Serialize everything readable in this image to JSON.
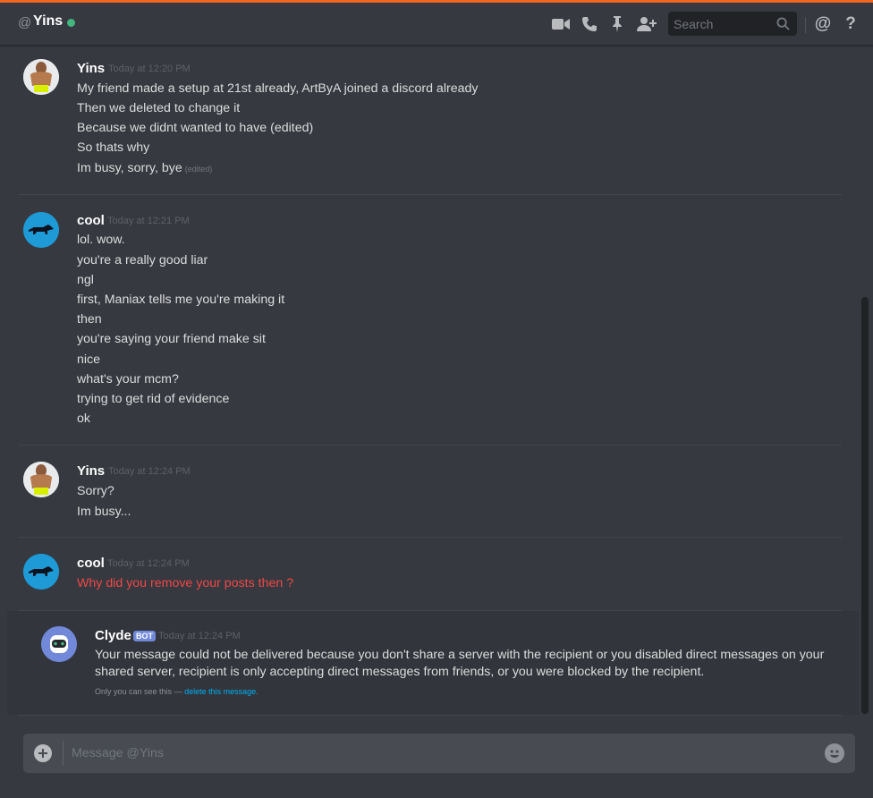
{
  "header": {
    "at_symbol": "@",
    "username": "Yins",
    "status_color": "#43b581",
    "search_placeholder": "Search",
    "icons": [
      "video-icon",
      "phone-icon",
      "pin-icon",
      "add-friend-icon",
      "search-icon",
      "mention-icon",
      "help-icon"
    ],
    "mention_glyph": "@",
    "help_glyph": "?"
  },
  "messages": [
    {
      "author": "Yins",
      "timestamp": "Today at 12:20 PM",
      "lines": [
        "My friend made a setup at 21st already, ArtByA joined a discord already",
        "Then we deleted to change it",
        "Because we didnt wanted to have (edited)",
        "So thats why",
        "Im busy, sorry, bye"
      ],
      "edited_label": "(edited)"
    },
    {
      "author": "cool",
      "timestamp": "Today at 12:21 PM",
      "lines": [
        "lol. wow.",
        "you're a really good liar",
        "ngl",
        "first, Maniax tells me you're making it",
        "then",
        "you're saying your friend make sit",
        "nice",
        "what's your mcm?",
        "trying to get rid of evidence",
        "ok"
      ]
    },
    {
      "author": "Yins",
      "timestamp": "Today at 12:24 PM",
      "lines": [
        "Sorry?",
        "Im busy..."
      ]
    },
    {
      "author": "cool",
      "timestamp": "Today at 12:24 PM",
      "lines": [
        "Why did you remove your posts then ?"
      ],
      "failed_color": "#f04747"
    }
  ],
  "clyde": {
    "author": "Clyde",
    "badge": "BOT",
    "timestamp": "Today at 12:24 PM",
    "text": "Your message could not be delivered because you don't share a server with the recipient or you disabled direct messages on your shared server, recipient is only accepting direct messages from friends, or you were blocked by the recipient.",
    "only_you_prefix": "Only you can see this —",
    "delete_link": "delete this message",
    "suffix": "."
  },
  "composer": {
    "placeholder": "Message @Yins"
  },
  "colors": {
    "accent_top": "#f26522",
    "background": "#36393f",
    "link": "#00b0f4",
    "bot_badge": "#7289da"
  }
}
